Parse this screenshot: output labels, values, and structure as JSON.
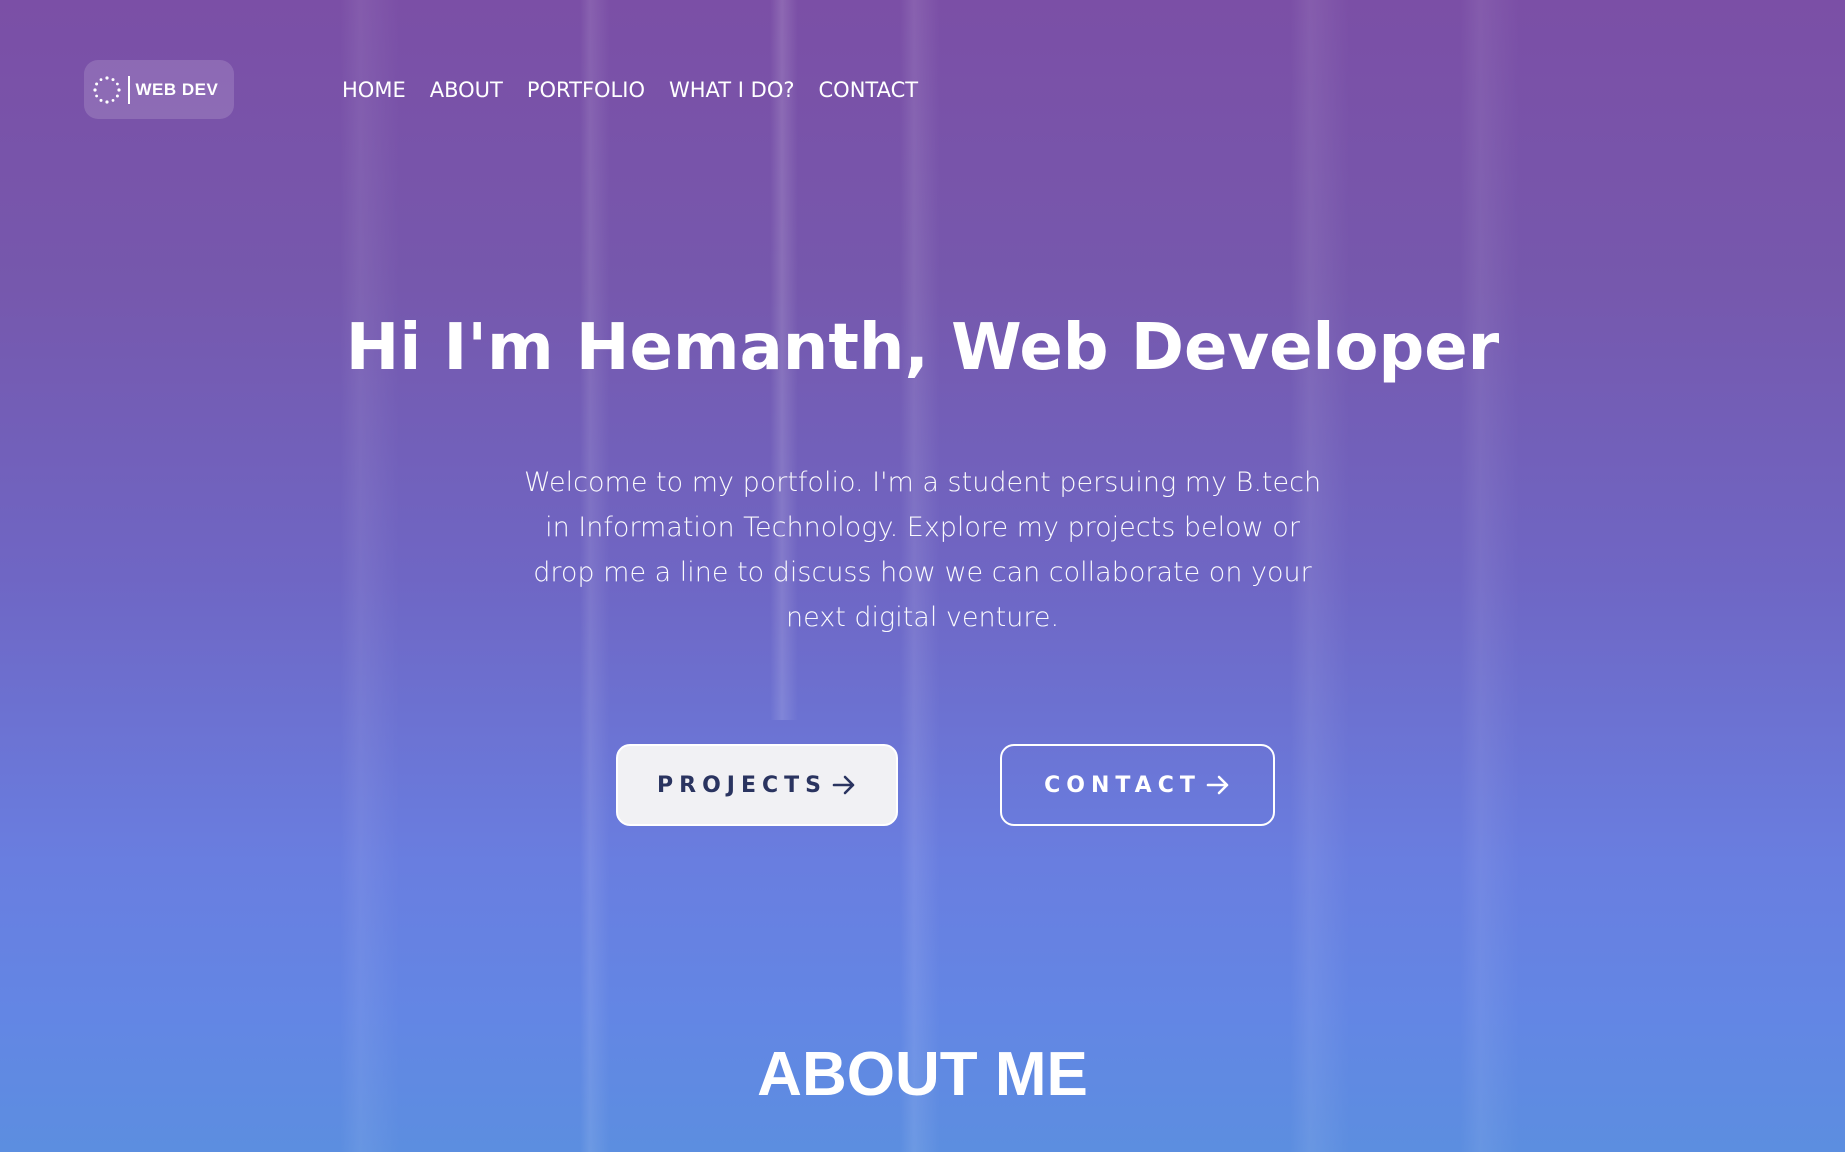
{
  "header": {
    "logo_text": "WEB DEV",
    "logo_icon": "dotted-ring-icon",
    "nav": [
      {
        "label": "HOME"
      },
      {
        "label": "ABOUT"
      },
      {
        "label": "PORTFOLIO"
      },
      {
        "label": "WHAT I DO?"
      },
      {
        "label": "CONTACT"
      }
    ]
  },
  "hero": {
    "title": "Hi I'm Hemanth, Web Developer",
    "text": "Welcome to my portfolio. I'm a student persuing my B.tech in Information Technology. Explore my projects below or drop me a line to discuss how we can collaborate on your next digital venture.",
    "buttons": {
      "projects_label": "PROJECTS",
      "contact_label": "CONTACT",
      "arrow_icon": "arrow-right-icon"
    }
  },
  "about": {
    "title": "ABOUT ME"
  },
  "colors": {
    "gradient_top": "#7b4fa6",
    "gradient_bottom": "#5c8ee0",
    "button_fill": "#f1f1f4",
    "button_text_dark": "#2a3460",
    "text": "#ffffff"
  }
}
